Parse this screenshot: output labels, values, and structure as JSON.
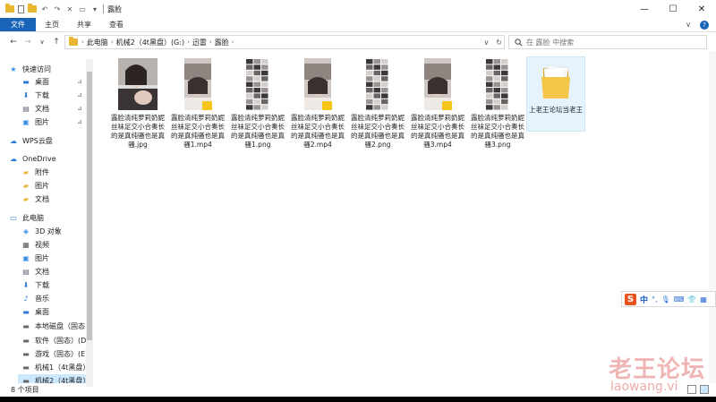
{
  "titlebar": {
    "title": "露脸",
    "controls": {
      "minimize": "—",
      "maximize": "☐",
      "close": "✕"
    }
  },
  "ribbon": {
    "tabs": [
      {
        "label": "文件",
        "active": true
      },
      {
        "label": "主页"
      },
      {
        "label": "共享"
      },
      {
        "label": "查看"
      }
    ],
    "expand_glyph": "∨",
    "help_glyph": "?"
  },
  "navigation": {
    "back": "←",
    "forward": "→",
    "recent": "∨",
    "up": "↑",
    "path": [
      "此电脑",
      "机械2（4t黑盘）(G:)",
      "迅雷",
      "露脸"
    ],
    "refresh": "↻",
    "dropdown": "∨"
  },
  "search": {
    "placeholder": "在 露脸 中搜索",
    "icon": "search-icon"
  },
  "sidebar": {
    "items": [
      {
        "label": "快速访问",
        "icon": "star-icon",
        "pinned": false
      },
      {
        "label": "桌面",
        "icon": "desktop-icon",
        "pinned": true
      },
      {
        "label": "下载",
        "icon": "download-icon",
        "pinned": true
      },
      {
        "label": "文档",
        "icon": "document-icon",
        "pinned": true
      },
      {
        "label": "图片",
        "icon": "picture-icon",
        "pinned": true
      },
      {
        "label": "WPS云盘",
        "icon": "cloud-icon",
        "pinned": false
      },
      {
        "label": "OneDrive",
        "icon": "cloud-icon",
        "pinned": false
      },
      {
        "label": "附件",
        "icon": "folder-icon",
        "pinned": false
      },
      {
        "label": "图片",
        "icon": "folder-icon",
        "pinned": false
      },
      {
        "label": "文档",
        "icon": "folder-icon",
        "pinned": false
      },
      {
        "label": "此电脑",
        "icon": "pc-icon",
        "pinned": false
      },
      {
        "label": "3D 对象",
        "icon": "cube-icon",
        "pinned": false
      },
      {
        "label": "视频",
        "icon": "video-icon",
        "pinned": false
      },
      {
        "label": "图片",
        "icon": "picture-icon",
        "pinned": false
      },
      {
        "label": "文档",
        "icon": "document-icon",
        "pinned": false
      },
      {
        "label": "下载",
        "icon": "download-icon",
        "pinned": false
      },
      {
        "label": "音乐",
        "icon": "music-icon",
        "pinned": false
      },
      {
        "label": "桌面",
        "icon": "desktop-icon",
        "pinned": false
      },
      {
        "label": "本地磁盘（固态",
        "icon": "drive-icon",
        "pinned": false
      },
      {
        "label": "软件（固态）(D",
        "icon": "drive-icon",
        "pinned": false
      },
      {
        "label": "游戏（固态）(E",
        "icon": "drive-icon",
        "pinned": false
      },
      {
        "label": "机械1（4t黑盘）",
        "icon": "drive-icon",
        "pinned": false
      },
      {
        "label": "机械2（4t黑盘）",
        "icon": "drive-icon",
        "pinned": false,
        "selected": true
      }
    ],
    "pin_glyph": "📌"
  },
  "files": [
    {
      "name": "露脸清纯萝莉奶妮丝袜足交小合奏长的是真纯骚也是真骚.jpg",
      "kind": "photo"
    },
    {
      "name": "露脸清纯萝莉奶妮丝袜足交小合奏长的是真纯骚也是真骚1.mp4",
      "kind": "video"
    },
    {
      "name": "露脸清纯萝莉奶妮丝袜足交小合奏长的是真纯骚也是真骚1.png",
      "kind": "grid"
    },
    {
      "name": "露脸清纯萝莉奶妮丝袜足交小合奏长的是真纯骚也是真骚2.mp4",
      "kind": "video"
    },
    {
      "name": "露脸清纯萝莉奶妮丝袜足交小合奏长的是真纯骚也是真骚2.png",
      "kind": "grid"
    },
    {
      "name": "露脸清纯萝莉奶妮丝袜足交小合奏长的是真纯骚也是真骚3.mp4",
      "kind": "video"
    },
    {
      "name": "露脸清纯萝莉奶妮丝袜足交小合奏长的是真纯骚也是真骚3.png",
      "kind": "grid"
    }
  ],
  "folder": {
    "name": "上老王论坛当老王"
  },
  "status": {
    "count": "8 个项目"
  },
  "ime": {
    "logo": "S",
    "mode": "中",
    "punct": "°,"
  },
  "watermark": {
    "cn": "老王论坛",
    "en": "laowang.vi"
  },
  "colors": {
    "accent": "#1a64b8",
    "folder": "#e8b630",
    "video_badge": "#f5c518",
    "selection": "#e5f3ff"
  }
}
